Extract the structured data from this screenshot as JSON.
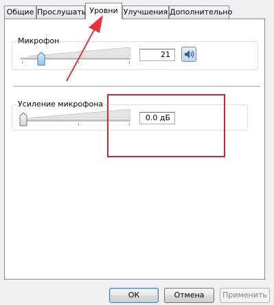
{
  "tabs": [
    {
      "label": "Общие",
      "active": false
    },
    {
      "label": "Прослушать",
      "active": false
    },
    {
      "label": "Уровни",
      "active": true
    },
    {
      "label": "Улучшения",
      "active": false
    },
    {
      "label": "Дополнительно",
      "active": false
    }
  ],
  "microphone": {
    "label": "Микрофон",
    "value": "21",
    "level_percent": 21,
    "icon": "speaker-icon"
  },
  "boost": {
    "label": "Усиление микрофона",
    "value": "0.0 дБ",
    "level_percent": 0
  },
  "buttons": {
    "ok": "ОК",
    "cancel": "Отмена",
    "apply": "Применить"
  },
  "annotation_colors": {
    "arrow": "#e8323c",
    "highlight_box": "#d9202f"
  }
}
